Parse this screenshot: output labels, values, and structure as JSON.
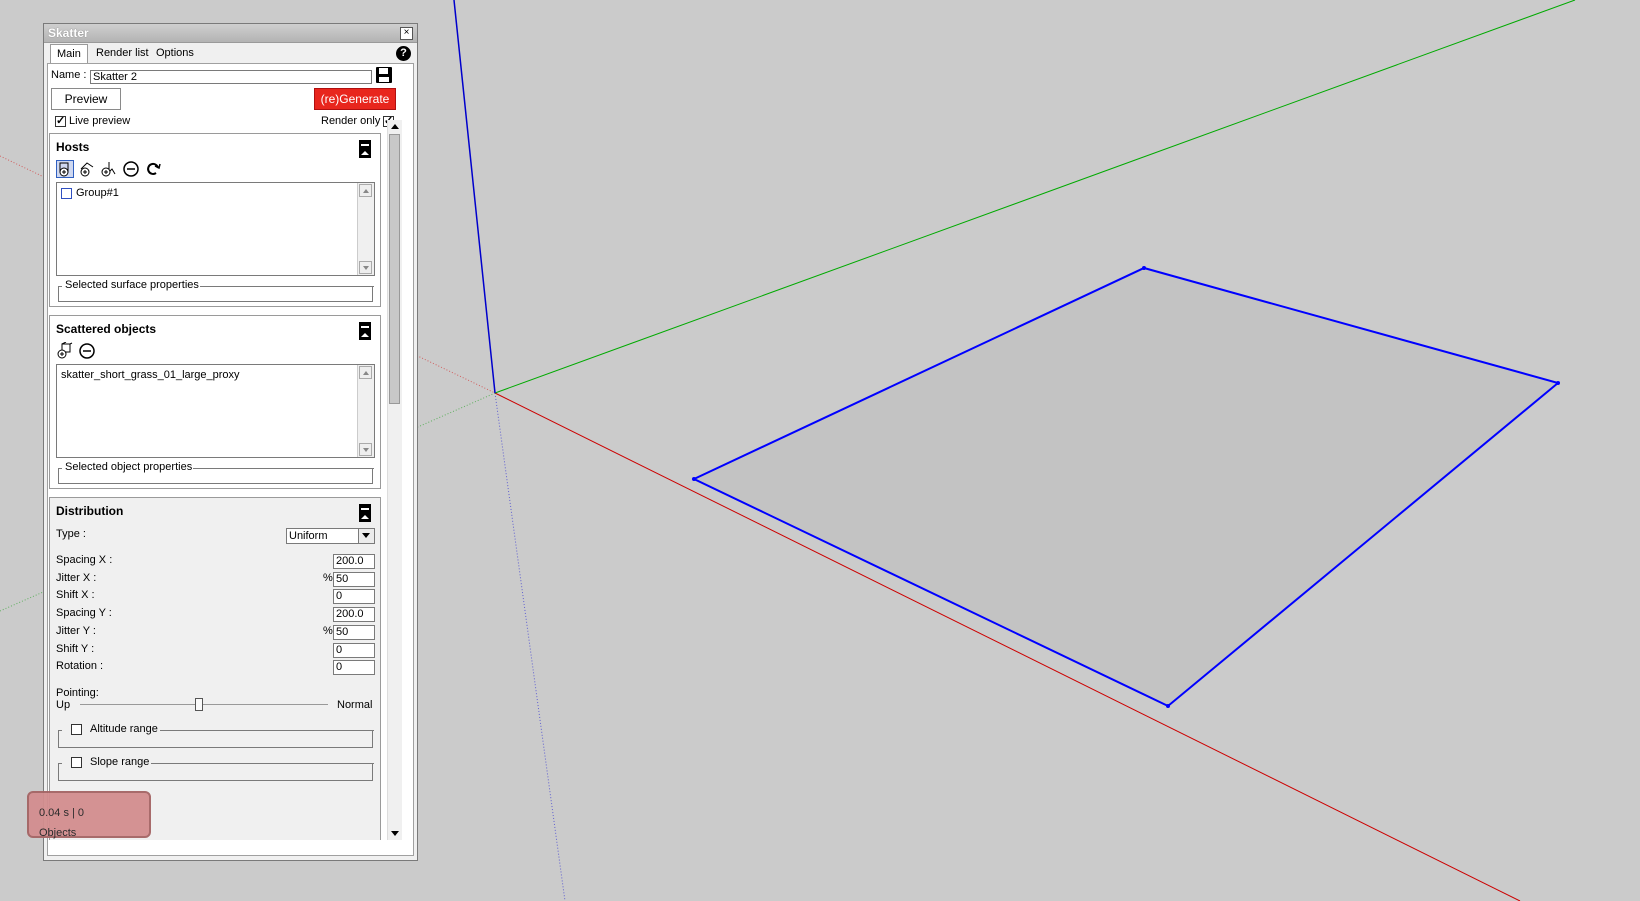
{
  "app": {
    "title": "Skatter",
    "close_symbol": "×",
    "help_symbol": "?"
  },
  "tabs": [
    {
      "label": "Main",
      "active": true
    },
    {
      "label": "Render list",
      "active": false
    },
    {
      "label": "Options",
      "active": false
    }
  ],
  "main": {
    "name_label": "Name :",
    "name_value": "Skatter 2",
    "preview_label": "Preview",
    "generate_label": "(re)Generate",
    "live_preview_label": "Live preview",
    "live_preview_checked": "✓",
    "render_only_label": "Render only",
    "render_only_checked": "✓"
  },
  "hosts": {
    "title": "Hosts",
    "items": [
      "Group#1"
    ],
    "properties_label": "Selected surface properties"
  },
  "scattered": {
    "title": "Scattered objects",
    "items": [
      "skatter_short_grass_01_large_proxy"
    ],
    "properties_label": "Selected object properties"
  },
  "distribution": {
    "title": "Distribution",
    "type_label": "Type :",
    "type_value": "Uniform",
    "fields": [
      {
        "label": "Spacing X :",
        "value": "200.0",
        "unit": ""
      },
      {
        "label": "Jitter X :",
        "value": "50",
        "unit": "%"
      },
      {
        "label": "Shift X :",
        "value": "0",
        "unit": ""
      },
      {
        "label": "Spacing Y :",
        "value": "200.0",
        "unit": ""
      },
      {
        "label": "Jitter Y :",
        "value": "50",
        "unit": "%"
      },
      {
        "label": "Shift Y :",
        "value": "0",
        "unit": ""
      },
      {
        "label": "Rotation :",
        "value": "0",
        "unit": ""
      }
    ],
    "pointing_label": "Pointing:",
    "pointing_left": "Up",
    "pointing_right": "Normal",
    "pointing_level": 0.48,
    "altitude_label": "Altitude range",
    "slope_label": "Slope range"
  },
  "status": {
    "text": "0.04 s | 0 Objects"
  },
  "colors": {
    "generate_bg": "#e8261d",
    "axis_red": "#cc0000",
    "axis_green": "#00aa00",
    "axis_blue": "#0000cc",
    "face_fill": "#c3c3c3",
    "status_bg": "#d38d8f"
  }
}
